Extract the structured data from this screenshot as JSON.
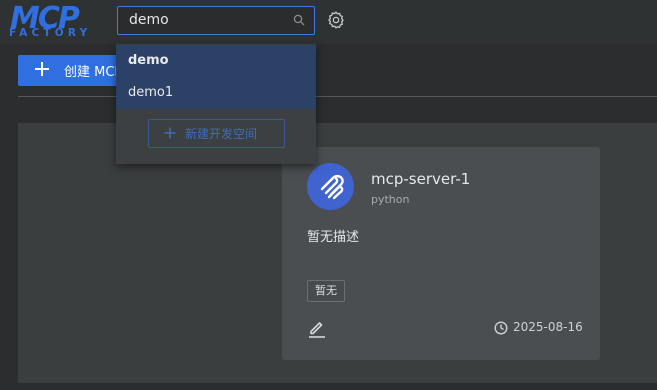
{
  "header": {
    "logo_text": "MCP",
    "logo_subtext": "FACTORY",
    "search": {
      "value": "demo"
    },
    "icons": {
      "search": "search-icon",
      "settings": "gear-icon"
    },
    "accent_color": "#2f6fe0"
  },
  "toolbar": {
    "create_label": "创建 MCP"
  },
  "dropdown": {
    "items": [
      {
        "label": "demo",
        "selected": true
      },
      {
        "label": "demo1",
        "selected": false
      }
    ],
    "new_space_label": "新建开发空间"
  },
  "card": {
    "title": "mcp-server-1",
    "language": "python",
    "description": "暂无描述",
    "tag": "暂无",
    "date": "2025-08-16",
    "avatar_color": "#3f63cf",
    "icons": {
      "avatar": "mcp-logo-icon",
      "edit": "edit-icon",
      "clock": "clock-icon"
    }
  }
}
